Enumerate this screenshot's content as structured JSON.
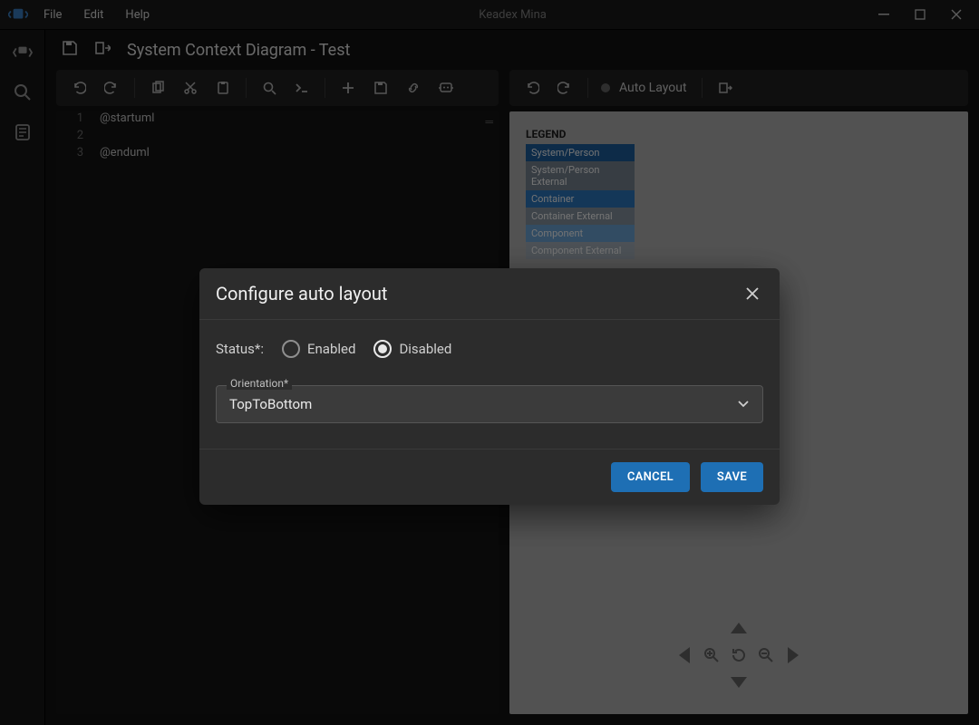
{
  "app": {
    "title": "Keadex Mina"
  },
  "menu": {
    "file": "File",
    "edit": "Edit",
    "help": "Help"
  },
  "page": {
    "title": "System Context Diagram - Test"
  },
  "editor_toolbar": {
    "auto_layout_label": "Auto Layout"
  },
  "editor": {
    "lines": [
      {
        "n": "1",
        "text": "@startuml"
      },
      {
        "n": "2",
        "text": ""
      },
      {
        "n": "3",
        "text": "@enduml"
      }
    ]
  },
  "legend": {
    "title": "LEGEND",
    "items": [
      {
        "label": "System/Person",
        "color": "#1e5fa0"
      },
      {
        "label": "System/Person External",
        "color": "#7b8794"
      },
      {
        "label": "Container",
        "color": "#2d7bc4"
      },
      {
        "label": "Container External",
        "color": "#8b98a5"
      },
      {
        "label": "Component",
        "color": "#6fa8dc"
      },
      {
        "label": "Component External",
        "color": "#a9b4bf"
      }
    ]
  },
  "modal": {
    "title": "Configure auto layout",
    "status_label": "Status*:",
    "enabled_label": "Enabled",
    "disabled_label": "Disabled",
    "selected_status": "disabled",
    "orientation_label": "Orientation*",
    "orientation_value": "TopToBottom",
    "cancel": "CANCEL",
    "save": "SAVE"
  }
}
